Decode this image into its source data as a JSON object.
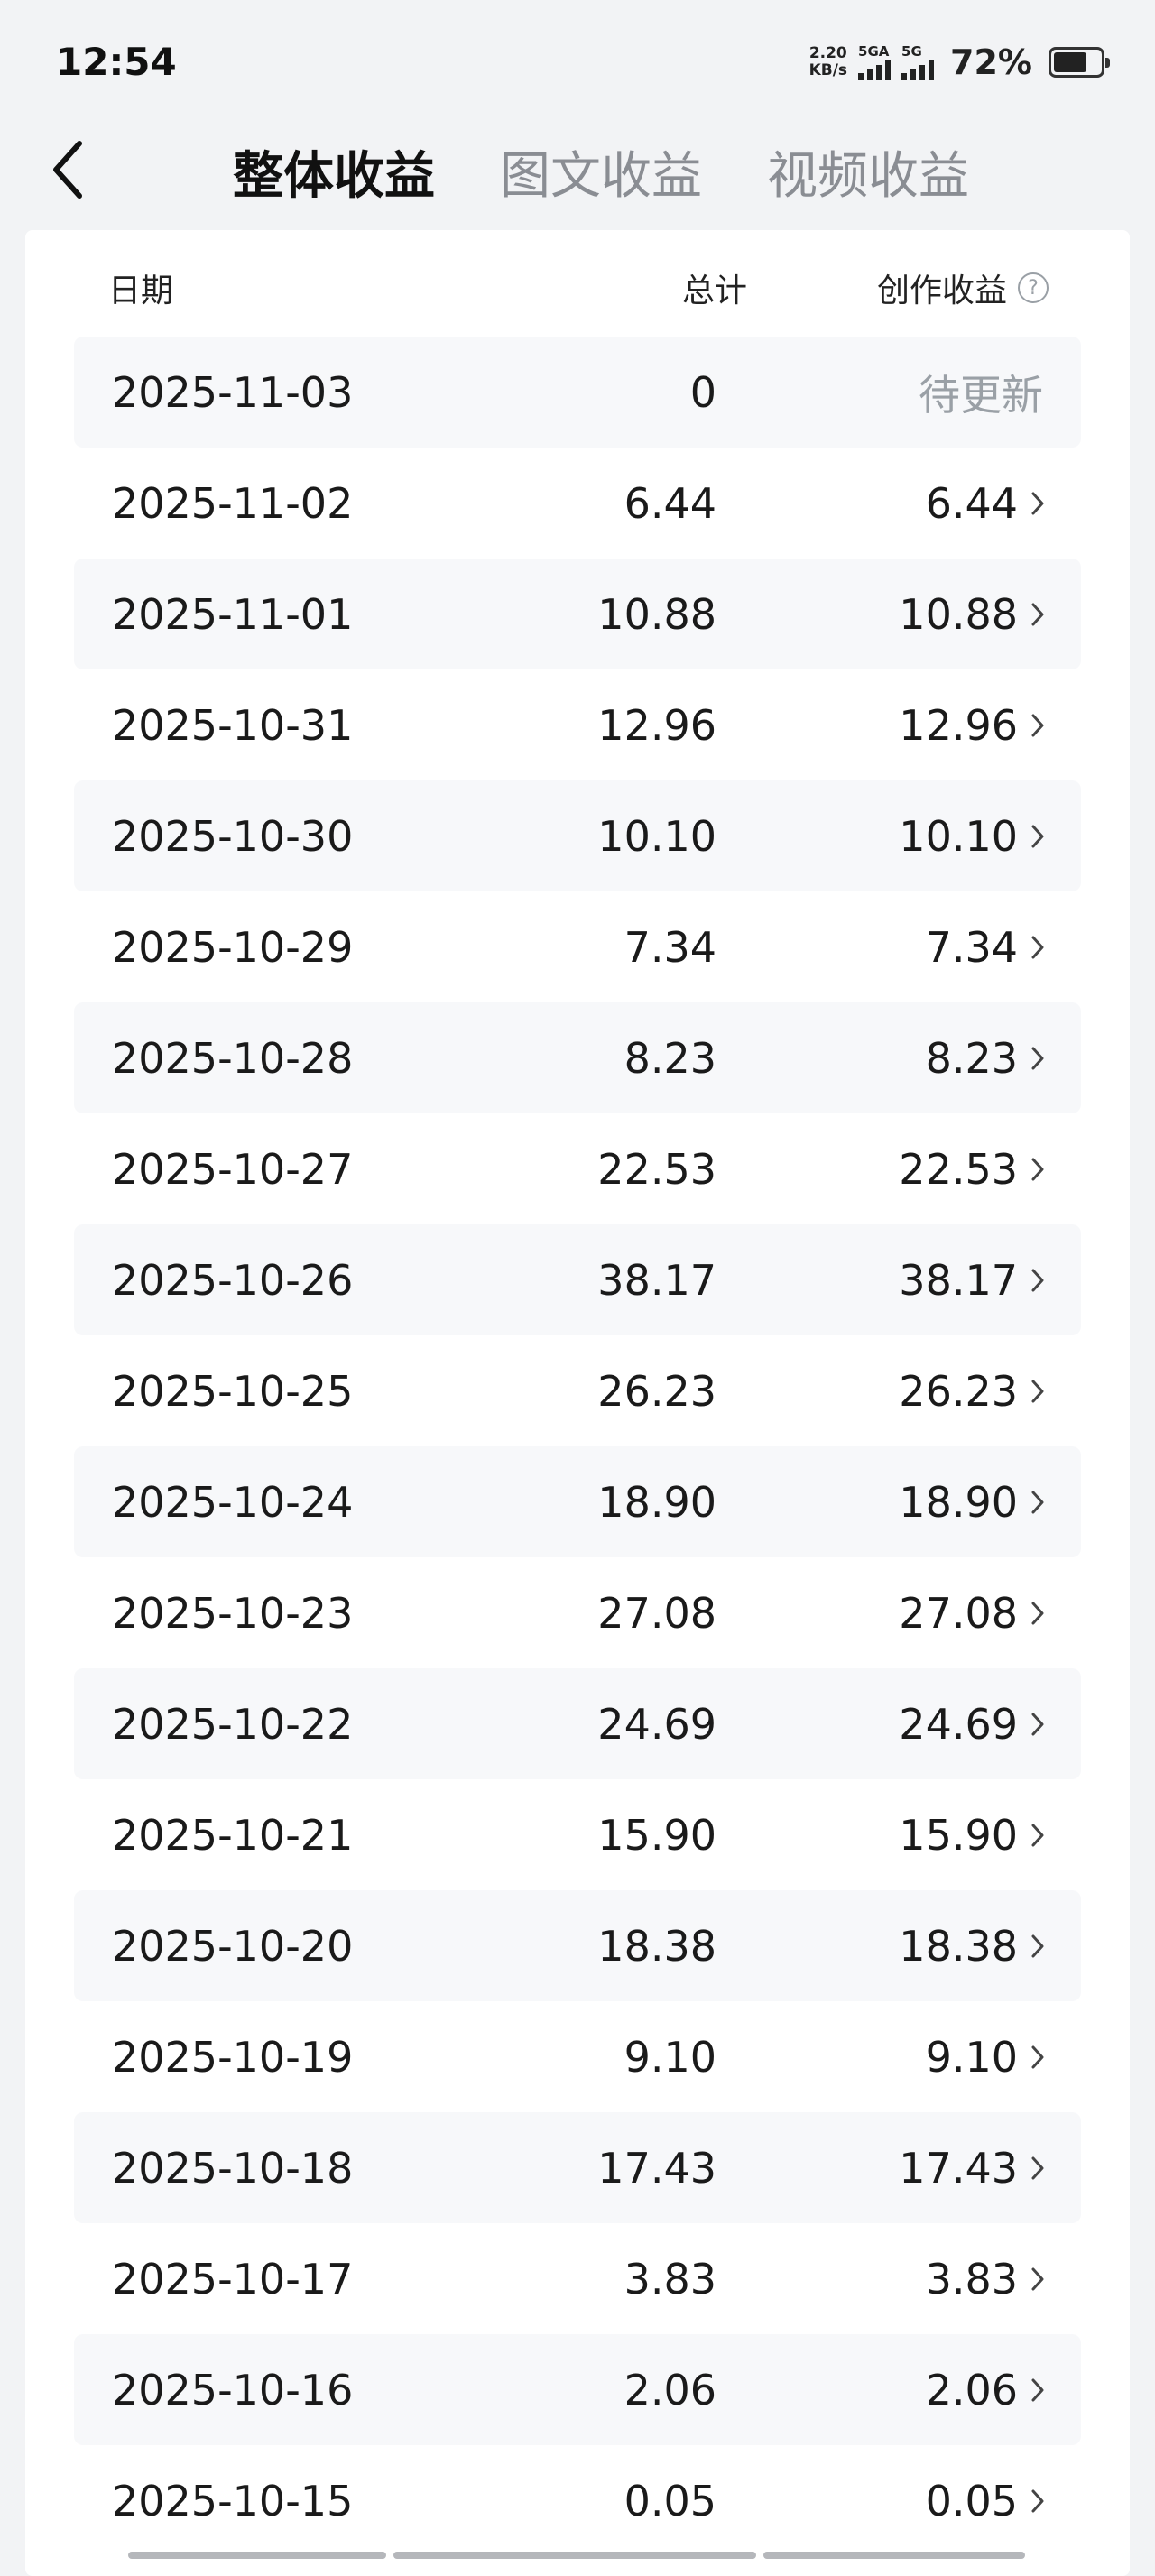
{
  "status_bar": {
    "time": "12:54",
    "net_speed_value": "2.20",
    "net_speed_unit": "KB/s",
    "sim1_label": "5GA",
    "sim2_label": "5G",
    "battery_percent": "72%",
    "battery_level": 0.72
  },
  "header": {
    "tabs": [
      {
        "label": "整体收益",
        "active": true
      },
      {
        "label": "图文收益",
        "active": false
      },
      {
        "label": "视频收益",
        "active": false
      }
    ]
  },
  "table": {
    "columns": [
      "日期",
      "总计",
      "创作收益"
    ],
    "help_symbol": "?",
    "rows": [
      {
        "date": "2025-11-03",
        "total": "0",
        "earn": "待更新",
        "pending": true
      },
      {
        "date": "2025-11-02",
        "total": "6.44",
        "earn": "6.44"
      },
      {
        "date": "2025-11-01",
        "total": "10.88",
        "earn": "10.88"
      },
      {
        "date": "2025-10-31",
        "total": "12.96",
        "earn": "12.96"
      },
      {
        "date": "2025-10-30",
        "total": "10.10",
        "earn": "10.10"
      },
      {
        "date": "2025-10-29",
        "total": "7.34",
        "earn": "7.34"
      },
      {
        "date": "2025-10-28",
        "total": "8.23",
        "earn": "8.23"
      },
      {
        "date": "2025-10-27",
        "total": "22.53",
        "earn": "22.53"
      },
      {
        "date": "2025-10-26",
        "total": "38.17",
        "earn": "38.17"
      },
      {
        "date": "2025-10-25",
        "total": "26.23",
        "earn": "26.23"
      },
      {
        "date": "2025-10-24",
        "total": "18.90",
        "earn": "18.90"
      },
      {
        "date": "2025-10-23",
        "total": "27.08",
        "earn": "27.08"
      },
      {
        "date": "2025-10-22",
        "total": "24.69",
        "earn": "24.69"
      },
      {
        "date": "2025-10-21",
        "total": "15.90",
        "earn": "15.90"
      },
      {
        "date": "2025-10-20",
        "total": "18.38",
        "earn": "18.38"
      },
      {
        "date": "2025-10-19",
        "total": "9.10",
        "earn": "9.10"
      },
      {
        "date": "2025-10-18",
        "total": "17.43",
        "earn": "17.43"
      },
      {
        "date": "2025-10-17",
        "total": "3.83",
        "earn": "3.83"
      },
      {
        "date": "2025-10-16",
        "total": "2.06",
        "earn": "2.06"
      },
      {
        "date": "2025-10-15",
        "total": "0.05",
        "earn": "0.05"
      }
    ]
  }
}
